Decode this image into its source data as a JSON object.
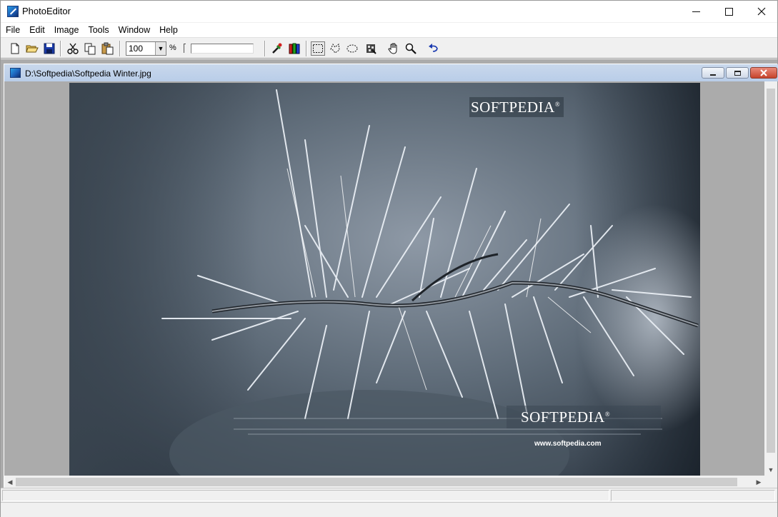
{
  "window": {
    "title": "PhotoEditor"
  },
  "menu": {
    "items": [
      "File",
      "Edit",
      "Image",
      "Tools",
      "Window",
      "Help"
    ]
  },
  "toolbar": {
    "buttons": [
      {
        "name": "new-icon"
      },
      {
        "name": "open-folder-icon"
      },
      {
        "name": "save-icon"
      },
      {
        "name": "cut-icon"
      },
      {
        "name": "copy-icon"
      },
      {
        "name": "paste-icon"
      },
      {
        "name": "color-picker-icon"
      },
      {
        "name": "color-channels-icon"
      },
      {
        "name": "rect-select-icon"
      },
      {
        "name": "lasso-select-icon"
      },
      {
        "name": "ellipse-select-icon"
      },
      {
        "name": "magic-wand-icon"
      },
      {
        "name": "hand-pan-icon"
      },
      {
        "name": "zoom-icon"
      },
      {
        "name": "undo-icon"
      }
    ],
    "zoom_value": "100",
    "zoom_unit": "%",
    "slider_value": 0.0
  },
  "document": {
    "title": "D:\\Softpedia\\Softpedia Winter.jpg",
    "watermark_top": "SOFTPEDIA",
    "watermark_bottom": "SOFTPEDIA",
    "watermark_url": "www.softpedia.com",
    "watermark_registered": "®"
  },
  "colors": {
    "titlebar": "#ffffff",
    "workspace": "#ababab",
    "child_caption": "#c0d2ea",
    "close_button": "#d2553f"
  }
}
